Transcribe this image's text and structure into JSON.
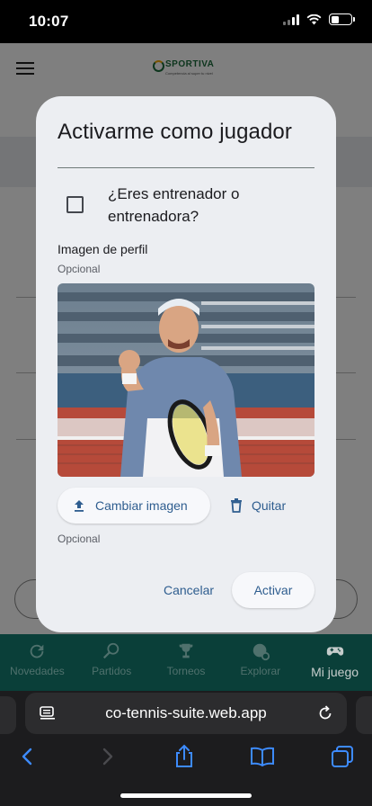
{
  "status_bar": {
    "time": "10:07"
  },
  "app": {
    "logo_text": "SPORTIVA",
    "logo_tagline": "Competencia al super tu nivel"
  },
  "dialog": {
    "title": "Activarme como jugador",
    "checkbox_label": "¿Eres entrenador o entrenadora?",
    "checkbox_checked": false,
    "image_label": "Imagen de perfil",
    "image_optional": "Opcional",
    "change_image_label": "Cambiar imagen",
    "remove_label": "Quitar",
    "second_optional": "Opcional",
    "cancel_label": "Cancelar",
    "activate_label": "Activar"
  },
  "bottom_nav": {
    "items": [
      {
        "label": "Novedades",
        "icon": "refresh-icon",
        "active": false
      },
      {
        "label": "Partidos",
        "icon": "racket-icon",
        "active": false
      },
      {
        "label": "Torneos",
        "icon": "trophy-icon",
        "active": false
      },
      {
        "label": "Explorar",
        "icon": "explore-icon",
        "active": false
      },
      {
        "label": "Mi juego",
        "icon": "gamepad-icon",
        "active": true
      }
    ]
  },
  "browser": {
    "url": "co-tennis-suite.web.app"
  },
  "colors": {
    "accent": "#2e5d8f",
    "nav_bg": "#0c4a43",
    "dialog_bg": "#eceef2"
  }
}
